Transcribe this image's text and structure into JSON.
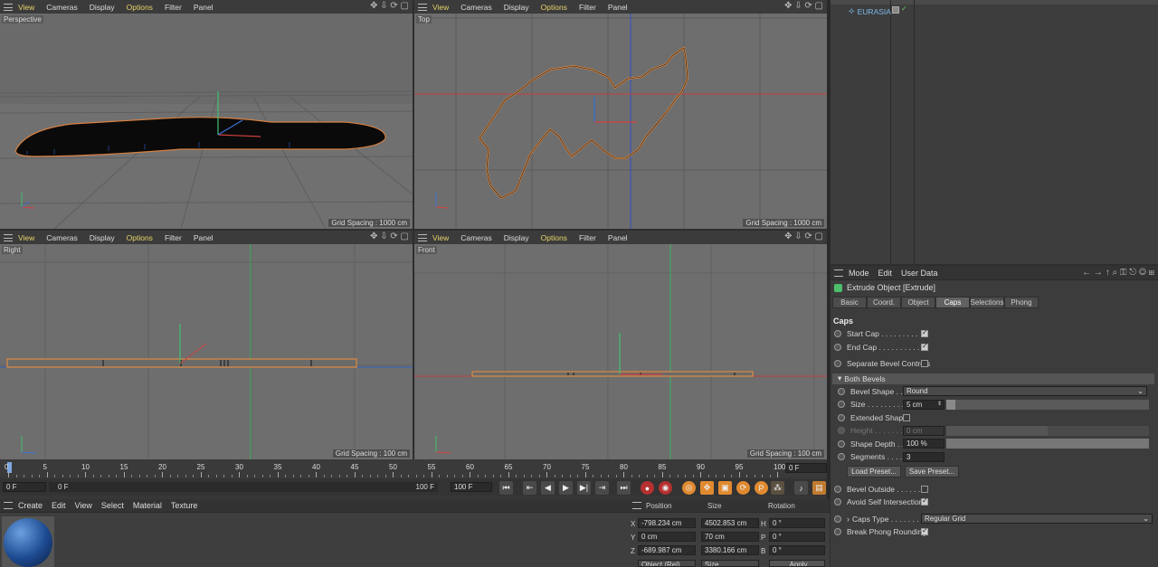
{
  "viewport_menu": [
    "View",
    "Cameras",
    "Display",
    "Options",
    "Filter",
    "Panel"
  ],
  "viewports": {
    "perspective": {
      "label": "Perspective",
      "grid": "Grid Spacing : 1000 cm"
    },
    "top": {
      "label": "Top",
      "grid": "Grid Spacing : 1000 cm"
    },
    "right": {
      "label": "Right",
      "grid": "Grid Spacing : 100 cm"
    },
    "front": {
      "label": "Front",
      "grid": "Grid Spacing : 100 cm"
    }
  },
  "object_manager": {
    "item": "EURASIA"
  },
  "attributes": {
    "menu": [
      "Mode",
      "Edit",
      "User Data"
    ],
    "object_title": "Extrude Object [Extrude]",
    "tabs": [
      "Basic",
      "Coord.",
      "Object",
      "Caps",
      "Selections",
      "Phong"
    ],
    "active_tab": "Caps",
    "section": "Caps",
    "start_cap": "Start Cap . . . . . . . . .",
    "end_cap": "End Cap . . . . . . . . . .",
    "separate_bevel": "Separate Bevel Controls",
    "both_bevels": "Both Bevels",
    "bevel_shape_label": "Bevel Shape . . .",
    "bevel_shape_value": "Round",
    "size_label": "Size . . . . . . . . . . .",
    "size_value": "5 cm",
    "extended_shape": "Extended Shape",
    "height_label": "Height . . . . . . . . .",
    "height_value": "0 cm",
    "shape_depth_label": "Shape Depth . .",
    "shape_depth_value": "100 %",
    "segments_label": "Segments . . . . .",
    "segments_value": "3",
    "load_preset": "Load Preset...",
    "save_preset": "Save Preset...",
    "bevel_outside": "Bevel Outside . . . . . . .",
    "avoid_self": "Avoid Self Intersections",
    "caps_type_label": "Caps Type . . . . . . . .",
    "caps_type_value": "Regular Grid",
    "break_phong": "Break Phong Rounding"
  },
  "timeline": {
    "ticks": [
      "0",
      "5",
      "10",
      "15",
      "20",
      "25",
      "30",
      "35",
      "40",
      "45",
      "50",
      "55",
      "60",
      "65",
      "70",
      "75",
      "80",
      "85",
      "90",
      "95",
      "100"
    ],
    "current": "0 F",
    "start": "0 F",
    "min": "0 F",
    "end": "100 F",
    "max": "100 F"
  },
  "material_menu": [
    "Create",
    "Edit",
    "View",
    "Select",
    "Material",
    "Texture"
  ],
  "coordinates": {
    "headers": [
      "Position",
      "Size",
      "Rotation"
    ],
    "pos": [
      "-798.234 cm",
      "0 cm",
      "-689.987 cm"
    ],
    "size": [
      "4502.853 cm",
      "70 cm",
      "3380.166 cm"
    ],
    "rot": [
      "0 °",
      "0 °",
      "0 °"
    ],
    "axes": [
      "X",
      "Y",
      "Z"
    ],
    "rot_axes": [
      "H",
      "P",
      "B"
    ],
    "mode": "Object (Rel)",
    "size_mode": "Size",
    "apply": "Apply"
  }
}
